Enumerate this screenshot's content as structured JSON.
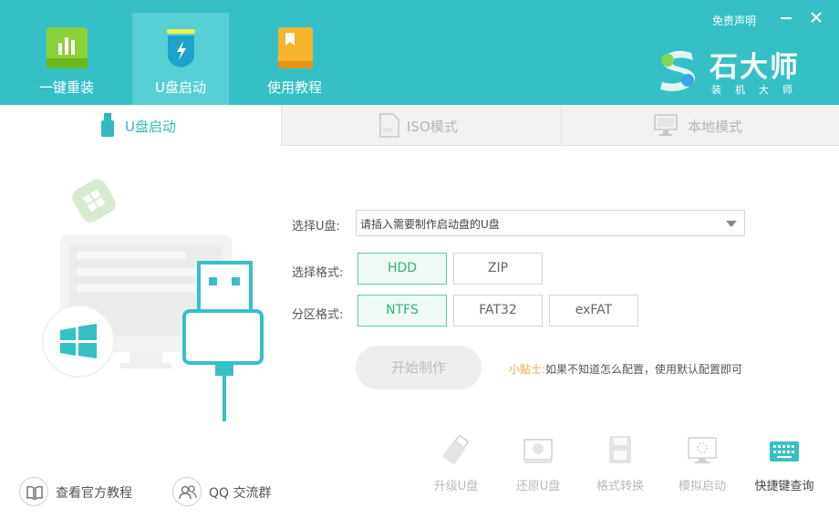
{
  "header": {
    "tabs": [
      {
        "label": "一键重装",
        "icon": "chart-icon"
      },
      {
        "label": "U盘启动",
        "icon": "usb-shield-icon",
        "active": true
      },
      {
        "label": "使用教程",
        "icon": "book-icon"
      }
    ],
    "disclaimer": "免责声明",
    "brand_name": "石大师",
    "brand_sub": "装机大师"
  },
  "mode_tabs": [
    {
      "label": "U盘启动",
      "active": true
    },
    {
      "label": "ISO模式"
    },
    {
      "label": "本地模式"
    }
  ],
  "form": {
    "usb_label": "选择U盘:",
    "usb_placeholder": "请插入需要制作启动盘的U盘",
    "format_label": "选择格式:",
    "formats": [
      "HDD",
      "ZIP"
    ],
    "selected_format": "HDD",
    "partition_label": "分区格式:",
    "partitions": [
      "NTFS",
      "FAT32",
      "exFAT"
    ],
    "selected_partition": "NTFS",
    "start_button": "开始制作",
    "tip_key": "小贴士:",
    "tip_text": "如果不知道怎么配置，使用默认配置即可"
  },
  "bottom": {
    "links": [
      {
        "label": "查看官方教程",
        "icon": "book-icon"
      },
      {
        "label": "QQ 交流群",
        "icon": "users-icon"
      }
    ],
    "tools": [
      {
        "label": "升级U盘",
        "icon": "usb-drive-icon"
      },
      {
        "label": "还原U盘",
        "icon": "restore-disk-icon"
      },
      {
        "label": "格式转换",
        "icon": "floppy-icon"
      },
      {
        "label": "模拟启动",
        "icon": "monitor-icon"
      },
      {
        "label": "快捷键查询",
        "icon": "keyboard-icon",
        "enabled": true
      }
    ]
  },
  "colors": {
    "header_bg": "#35c0c6",
    "accent": "#31b9be",
    "selected_green": "#2eb57c",
    "tip_orange": "#f2a33a"
  }
}
